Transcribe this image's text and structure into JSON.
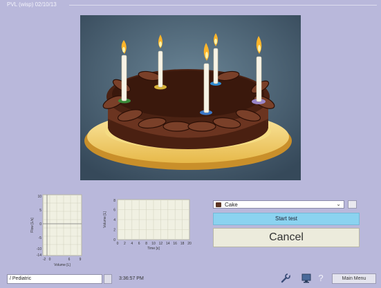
{
  "window": {
    "title": "PVL (wisp) 02/10/13"
  },
  "incentive": {
    "selected": "Cake",
    "icon": "cake-thumbnail-icon"
  },
  "buttons": {
    "start": "Start test",
    "cancel": "Cancel",
    "main_menu": "Main Menu"
  },
  "status": {
    "patient": "/ Pediatric",
    "time": "3:36:57 PM"
  },
  "colors": {
    "background": "#b9b8db",
    "start": "#8bd3f0",
    "cancel": "#ecebdc"
  },
  "chart_data": [
    {
      "type": "line",
      "xlabel": "Volume [L]",
      "ylabel": "Flow [L/s]",
      "xlim": [
        -2,
        9
      ],
      "ylim": [
        -14,
        10
      ],
      "x_ticks": [
        "-2",
        "0",
        "6",
        "9"
      ],
      "y_ticks": [
        "10",
        "5",
        "0",
        "-5",
        "-10",
        "-14"
      ],
      "series": []
    },
    {
      "type": "line",
      "xlabel": "Time [s]",
      "ylabel": "Volume [L]",
      "xlim": [
        0,
        20
      ],
      "ylim": [
        0,
        8
      ],
      "x_ticks": [
        "0",
        "2",
        "4",
        "6",
        "8",
        "10",
        "12",
        "14",
        "16",
        "18",
        "20"
      ],
      "y_ticks": [
        "0",
        "2",
        "4",
        "6",
        "8"
      ],
      "series": []
    }
  ]
}
